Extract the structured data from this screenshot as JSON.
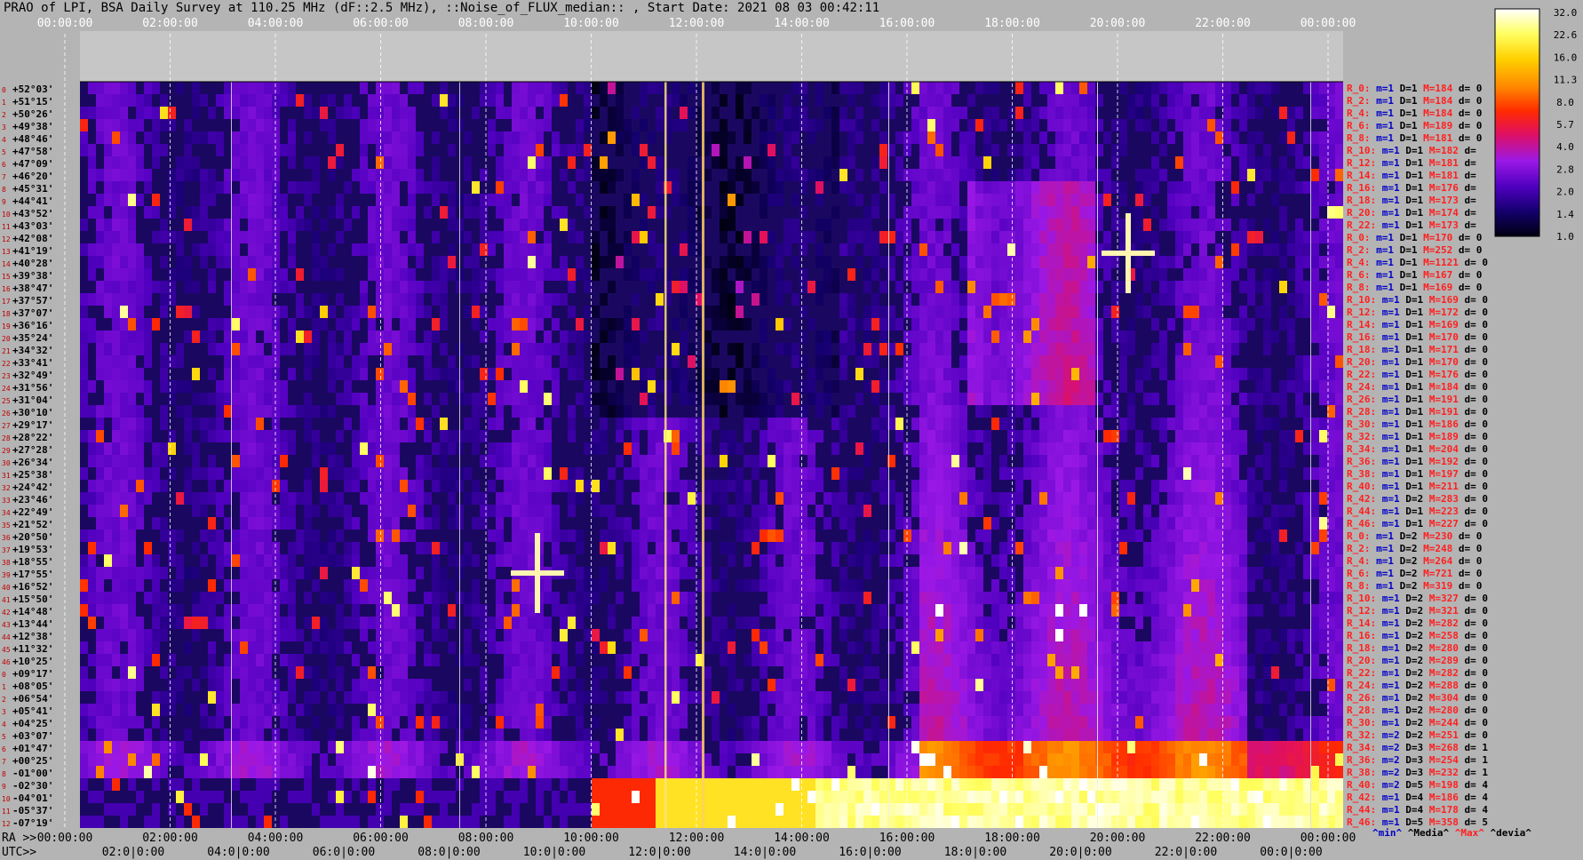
{
  "title": "PRAO of LPI, BSA Daily Survey at 110.25 MHz (dF::2.5 MHz), ::Noise_of_FLUX_median:: , Start Date: 2021 08 03 00:42:11",
  "chart_data": {
    "type": "heatmap",
    "title": "PRAO of LPI, BSA Daily Survey at 110.25 MHz (dF::2.5 MHz), ::Noise_of_FLUX_median:: , Start Date: 2021 08 03 00:42:11",
    "x_top_ticks": [
      "00:00:00",
      "02:00:00",
      "04:00:00",
      "06:00:00",
      "08:00:00",
      "10:00:00",
      "12:00:00",
      "14:00:00",
      "16:00:00",
      "18:00:00",
      "20:00:00",
      "22:00:00",
      "00:00:00"
    ],
    "ra_label": "RA >>",
    "ra_ticks": [
      "00:00:00",
      "02:00:00",
      "04:00:00",
      "06:00:00",
      "08:00:00",
      "10:00:00",
      "12:00:00",
      "14:00:00",
      "16:00:00",
      "18:00:00",
      "20:00:00",
      "22:00:00",
      "00:00:00"
    ],
    "utc_label": "UTC>>",
    "utc_ticks": [
      "02:0|0:00",
      "04:0|0:00",
      "06:0|0:00",
      "08:0|0:00",
      "10:0|0:00",
      "12:0|0:00",
      "14:0|0:00",
      "16:0|0:00",
      "18:0|0:00",
      "20:0|0:00",
      "22:0|0:00",
      "00:0|0:00"
    ],
    "declinations": [
      "+52°03'",
      "+51°15'",
      "+50°26'",
      "+49°38'",
      "+48°46'",
      "+47°58'",
      "+47°09'",
      "+46°20'",
      "+45°31'",
      "+44°41'",
      "+43°52'",
      "+43°03'",
      "+42°08'",
      "+41°19'",
      "+40°28'",
      "+39°38'",
      "+38°47'",
      "+37°57'",
      "+37°07'",
      "+36°16'",
      "+35°24'",
      "+34°32'",
      "+33°41'",
      "+32°49'",
      "+31°56'",
      "+31°04'",
      "+30°10'",
      "+29°17'",
      "+28°22'",
      "+27°28'",
      "+26°34'",
      "+25°38'",
      "+24°42'",
      "+23°46'",
      "+22°49'",
      "+21°52'",
      "+20°50'",
      "+19°53'",
      "+18°55'",
      "+17°55'",
      "+16°52'",
      "+15°50'",
      "+14°48'",
      "+13°44'",
      "+12°38'",
      "+11°32'",
      "+10°25'",
      "+09°17'",
      "+08°05'",
      "+06°54'",
      "+05°41'",
      "+04°25'",
      "+03°07'",
      "+01°47'",
      "+00°25'",
      "-01°00'",
      "-02°30'",
      "-04°01'",
      "-05°37'",
      "-07°19'"
    ],
    "row_indices": [
      "0",
      "1",
      "2",
      "3",
      "4",
      "5",
      "6",
      "7",
      "8",
      "9",
      "10",
      "11",
      "12",
      "13",
      "14",
      "15",
      "16",
      "17",
      "18",
      "19",
      "20",
      "21",
      "22",
      "23",
      "24",
      "25",
      "26",
      "27",
      "28",
      "29",
      "30",
      "31",
      "32",
      "33",
      "34",
      "35",
      "36",
      "37",
      "38",
      "39",
      "40",
      "41",
      "42",
      "43",
      "44",
      "45",
      "46",
      "0",
      "1",
      "2",
      "3",
      "4",
      "5",
      "6",
      "7",
      "8",
      "9",
      "10",
      "11",
      "12"
    ],
    "colorbar": {
      "ticks": [
        "32.0",
        "22.6",
        "16.0",
        "11.3",
        "8.0",
        "5.7",
        "4.0",
        "2.8",
        "2.0",
        "1.4",
        "1.0"
      ],
      "colors": [
        "#000010",
        "#14006e",
        "#5000c0",
        "#9a18e6",
        "#e01060",
        "#ff2a00",
        "#ff8a00",
        "#ffd000",
        "#ffff60",
        "#ffffff"
      ]
    },
    "info_rows": [
      {
        "r": "R_0:",
        "m": "m=1",
        "d": "D=1",
        "M": "M=184",
        "dv": "d= 0"
      },
      {
        "r": "R_2:",
        "m": "m=1",
        "d": "D=1",
        "M": "M=184",
        "dv": "d= 0"
      },
      {
        "r": "R_4:",
        "m": "m=1",
        "d": "D=1",
        "M": "M=184",
        "dv": "d= 0"
      },
      {
        "r": "R_6:",
        "m": "m=1",
        "d": "D=1",
        "M": "M=189",
        "dv": "d= 0"
      },
      {
        "r": "R_8:",
        "m": "m=1",
        "d": "D=1",
        "M": "M=181",
        "dv": "d= 0"
      },
      {
        "r": "R_10:",
        "m": "m=1",
        "d": "D=1",
        "M": "M=182",
        "dv": "d="
      },
      {
        "r": "R_12:",
        "m": "m=1",
        "d": "D=1",
        "M": "M=181",
        "dv": "d="
      },
      {
        "r": "R_14:",
        "m": "m=1",
        "d": "D=1",
        "M": "M=181",
        "dv": "d="
      },
      {
        "r": "R_16:",
        "m": "m=1",
        "d": "D=1",
        "M": "M=176",
        "dv": "d="
      },
      {
        "r": "R_18:",
        "m": "m=1",
        "d": "D=1",
        "M": "M=173",
        "dv": "d="
      },
      {
        "r": "R_20:",
        "m": "m=1",
        "d": "D=1",
        "M": "M=174",
        "dv": "d="
      },
      {
        "r": "R_22:",
        "m": "m=1",
        "d": "D=1",
        "M": "M=173",
        "dv": "d="
      },
      {
        "r": "R_0:",
        "m": "m=1",
        "d": "D=1",
        "M": "M=170",
        "dv": "d= 0"
      },
      {
        "r": "R_2:",
        "m": "m=1",
        "d": "D=1",
        "M": "M=252",
        "dv": "d= 0"
      },
      {
        "r": "R_4:",
        "m": "m=1",
        "d": "D=1",
        "M": "M=1121",
        "dv": "d= 0"
      },
      {
        "r": "R_6:",
        "m": "m=1",
        "d": "D=1",
        "M": "M=167",
        "dv": "d= 0"
      },
      {
        "r": "R_8:",
        "m": "m=1",
        "d": "D=1",
        "M": "M=169",
        "dv": "d= 0"
      },
      {
        "r": "R_10:",
        "m": "m=1",
        "d": "D=1",
        "M": "M=169",
        "dv": "d= 0"
      },
      {
        "r": "R_12:",
        "m": "m=1",
        "d": "D=1",
        "M": "M=172",
        "dv": "d= 0"
      },
      {
        "r": "R_14:",
        "m": "m=1",
        "d": "D=1",
        "M": "M=169",
        "dv": "d= 0"
      },
      {
        "r": "R_16:",
        "m": "m=1",
        "d": "D=1",
        "M": "M=170",
        "dv": "d= 0"
      },
      {
        "r": "R_18:",
        "m": "m=1",
        "d": "D=1",
        "M": "M=171",
        "dv": "d= 0"
      },
      {
        "r": "R_20:",
        "m": "m=1",
        "d": "D=1",
        "M": "M=170",
        "dv": "d= 0"
      },
      {
        "r": "R_22:",
        "m": "m=1",
        "d": "D=1",
        "M": "M=176",
        "dv": "d= 0"
      },
      {
        "r": "R_24:",
        "m": "m=1",
        "d": "D=1",
        "M": "M=184",
        "dv": "d= 0"
      },
      {
        "r": "R_26:",
        "m": "m=1",
        "d": "D=1",
        "M": "M=191",
        "dv": "d= 0"
      },
      {
        "r": "R_28:",
        "m": "m=1",
        "d": "D=1",
        "M": "M=191",
        "dv": "d= 0"
      },
      {
        "r": "R_30:",
        "m": "m=1",
        "d": "D=1",
        "M": "M=186",
        "dv": "d= 0"
      },
      {
        "r": "R_32:",
        "m": "m=1",
        "d": "D=1",
        "M": "M=189",
        "dv": "d= 0"
      },
      {
        "r": "R_34:",
        "m": "m=1",
        "d": "D=1",
        "M": "M=204",
        "dv": "d= 0"
      },
      {
        "r": "R_36:",
        "m": "m=1",
        "d": "D=1",
        "M": "M=192",
        "dv": "d= 0"
      },
      {
        "r": "R_38:",
        "m": "m=1",
        "d": "D=1",
        "M": "M=197",
        "dv": "d= 0"
      },
      {
        "r": "R_40:",
        "m": "m=1",
        "d": "D=1",
        "M": "M=211",
        "dv": "d= 0"
      },
      {
        "r": "R_42:",
        "m": "m=1",
        "d": "D=2",
        "M": "M=283",
        "dv": "d= 0"
      },
      {
        "r": "R_44:",
        "m": "m=1",
        "d": "D=1",
        "M": "M=223",
        "dv": "d= 0"
      },
      {
        "r": "R_46:",
        "m": "m=1",
        "d": "D=1",
        "M": "M=227",
        "dv": "d= 0"
      },
      {
        "r": "R_0:",
        "m": "m=1",
        "d": "D=2",
        "M": "M=230",
        "dv": "d= 0"
      },
      {
        "r": "R_2:",
        "m": "m=1",
        "d": "D=2",
        "M": "M=248",
        "dv": "d= 0"
      },
      {
        "r": "R_4:",
        "m": "m=1",
        "d": "D=2",
        "M": "M=264",
        "dv": "d= 0"
      },
      {
        "r": "R_6:",
        "m": "m=1",
        "d": "D=2",
        "M": "M=721",
        "dv": "d= 0"
      },
      {
        "r": "R_8:",
        "m": "m=1",
        "d": "D=2",
        "M": "M=319",
        "dv": "d= 0"
      },
      {
        "r": "R_10:",
        "m": "m=1",
        "d": "D=2",
        "M": "M=327",
        "dv": "d= 0"
      },
      {
        "r": "R_12:",
        "m": "m=1",
        "d": "D=2",
        "M": "M=321",
        "dv": "d= 0"
      },
      {
        "r": "R_14:",
        "m": "m=1",
        "d": "D=2",
        "M": "M=282",
        "dv": "d= 0"
      },
      {
        "r": "R_16:",
        "m": "m=1",
        "d": "D=2",
        "M": "M=258",
        "dv": "d= 0"
      },
      {
        "r": "R_18:",
        "m": "m=1",
        "d": "D=2",
        "M": "M=280",
        "dv": "d= 0"
      },
      {
        "r": "R_20:",
        "m": "m=1",
        "d": "D=2",
        "M": "M=289",
        "dv": "d= 0"
      },
      {
        "r": "R_22:",
        "m": "m=1",
        "d": "D=2",
        "M": "M=282",
        "dv": "d= 0"
      },
      {
        "r": "R_24:",
        "m": "m=1",
        "d": "D=2",
        "M": "M=288",
        "dv": "d= 0"
      },
      {
        "r": "R_26:",
        "m": "m=1",
        "d": "D=2",
        "M": "M=304",
        "dv": "d= 0"
      },
      {
        "r": "R_28:",
        "m": "m=1",
        "d": "D=2",
        "M": "M=280",
        "dv": "d= 0"
      },
      {
        "r": "R_30:",
        "m": "m=1",
        "d": "D=2",
        "M": "M=244",
        "dv": "d= 0"
      },
      {
        "r": "R_32:",
        "m": "m=2",
        "d": "D=2",
        "M": "M=251",
        "dv": "d= 0"
      },
      {
        "r": "R_34:",
        "m": "m=2",
        "d": "D=3",
        "M": "M=268",
        "dv": "d= 1"
      },
      {
        "r": "R_36:",
        "m": "m=2",
        "d": "D=3",
        "M": "M=254",
        "dv": "d= 1"
      },
      {
        "r": "R_38:",
        "m": "m=2",
        "d": "D=3",
        "M": "M=232",
        "dv": "d= 1"
      },
      {
        "r": "R_40:",
        "m": "m=2",
        "d": "D=5",
        "M": "M=198",
        "dv": "d= 4"
      },
      {
        "r": "R_42:",
        "m": "m=1",
        "d": "D=4",
        "M": "M=186",
        "dv": "d= 4"
      },
      {
        "r": "R_44:",
        "m": "m=1",
        "d": "D=4",
        "M": "M=178",
        "dv": "d= 4"
      },
      {
        "r": "R_46:",
        "m": "m=1",
        "d": "D=5",
        "M": "M=358",
        "dv": "d= 5"
      }
    ],
    "legend": [
      {
        "label": "^min^",
        "color": "#0000c8"
      },
      {
        "label": "^Media^",
        "color": "#000000"
      },
      {
        "label": "^Max^",
        "color": "#ff2020"
      },
      {
        "label": "^devia^",
        "color": "#000000"
      }
    ]
  }
}
